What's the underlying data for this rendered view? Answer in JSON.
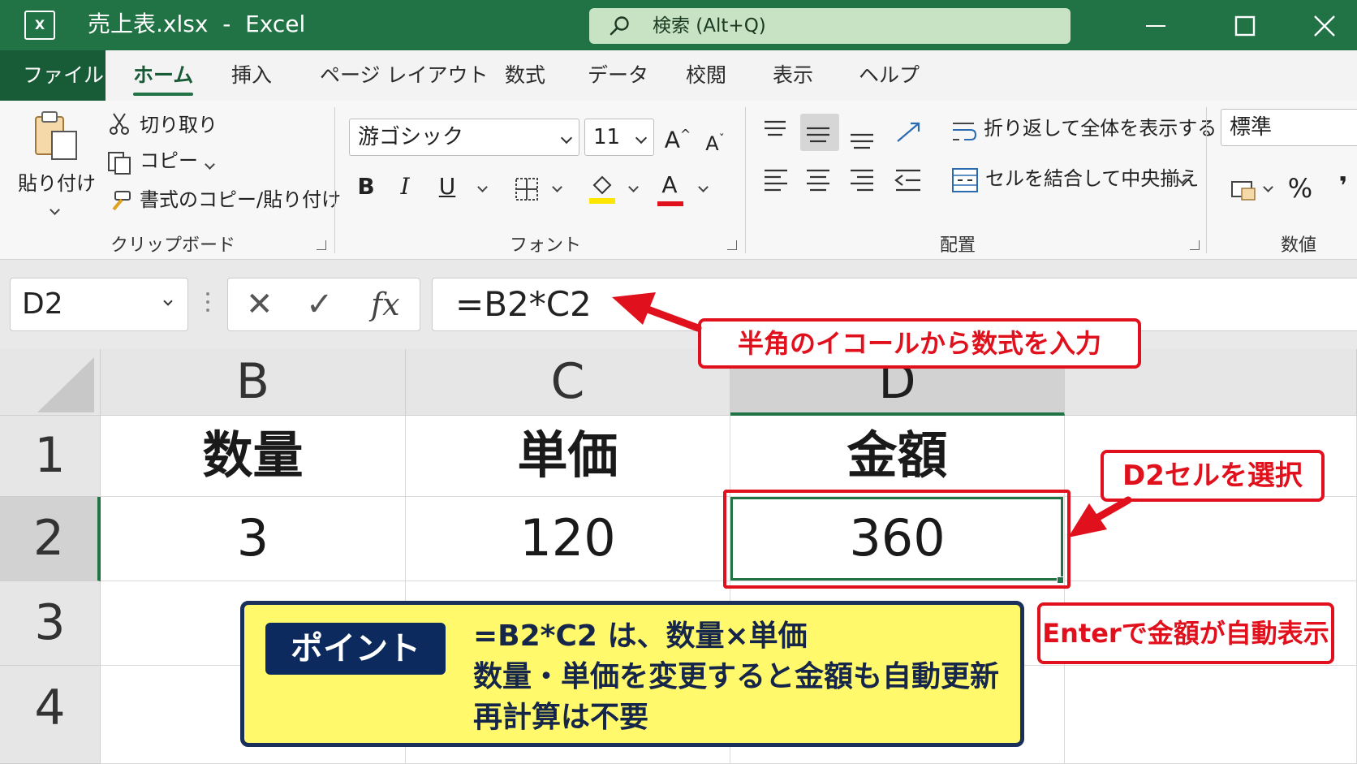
{
  "titlebar": {
    "title": "売上表.xlsx  -  Excel",
    "search_placeholder": "検索 (Alt+Q)",
    "logo_text": "X"
  },
  "tabs": [
    "ファイル",
    "ホーム",
    "挿入",
    "ページ レイアウト",
    "数式",
    "データ",
    "校閲",
    "表示",
    "ヘルプ"
  ],
  "ribbon": {
    "clipboard": {
      "paste": "貼り付け",
      "cut": "切り取り",
      "copy": "コピー",
      "format_painter": "書式のコピー/貼り付け",
      "label": "クリップボード"
    },
    "font": {
      "name": "游ゴシック",
      "size": "11",
      "label": "フォント",
      "bold": "B",
      "italic": "I",
      "underline": "U",
      "grow": "A",
      "shrink": "A",
      "color_letter": "A",
      "highlight_color": "#ffe600",
      "font_color": "#e0101c"
    },
    "alignment": {
      "wrap": "折り返して全体を表示する",
      "merge": "セルを結合して中央揃え",
      "label": "配置"
    },
    "number": {
      "format": "標準",
      "percent": "%",
      "comma": "❜",
      "label": "数値"
    }
  },
  "formula_bar": {
    "name_box": "D2",
    "formula": "=B2*C2",
    "cancel": "✕",
    "enter": "✓",
    "fx": "fx"
  },
  "sheet": {
    "columns": [
      "B",
      "C",
      "D"
    ],
    "rows": [
      "1",
      "2",
      "3",
      "4"
    ],
    "row1": [
      "数量",
      "単価",
      "金額"
    ],
    "row2": [
      "3",
      "120",
      "360"
    ]
  },
  "annotations": {
    "formula_callout": "半角のイコールから数式を入力",
    "select_callout": "D2セルを選択",
    "enter_callout": "Enterで金額が自動表示",
    "point_tag": "ポイント",
    "point_lines": [
      "=B2*C2 は、数量×単価",
      "数量・単価を変更すると金額も自動更新",
      "再計算は不要"
    ]
  },
  "colors": {
    "excel_green": "#217346",
    "annotation_red": "#e0101c",
    "point_yellow": "#fff96b",
    "point_navy": "#0d2a5e"
  }
}
